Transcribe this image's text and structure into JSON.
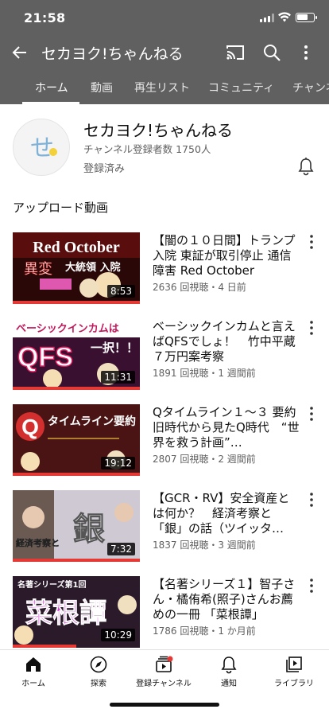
{
  "status_bar": {
    "time": "21:58"
  },
  "app_bar": {
    "title": "セカヨク!ちゃんねる",
    "icons": [
      "back-arrow-icon",
      "cast-icon",
      "search-icon",
      "more-vert-icon"
    ]
  },
  "tabs": [
    {
      "label": "ホーム",
      "active": true
    },
    {
      "label": "動画",
      "active": false
    },
    {
      "label": "再生リスト",
      "active": false
    },
    {
      "label": "コミュニティ",
      "active": false
    },
    {
      "label": "チャンネル",
      "active": false
    }
  ],
  "channel": {
    "name": "セカヨク!ちゃんねる",
    "subscribers": "チャンネル登録者数 1750人",
    "subscribed_label": "登録済み",
    "avatar_glyph": "せ"
  },
  "section": {
    "title": "アップロード動画"
  },
  "videos": [
    {
      "title": "【闇の１０日間】トランプ入院 東証が取引停止 通信障害 Red October",
      "meta": "2636 回視聴・4 日前",
      "duration": "8:53",
      "thumb_text": [
        "Red October",
        "異変",
        "大統領 入院"
      ],
      "progress": 1.0
    },
    {
      "title": "ベーシックインカムと言えばQFSでしょ！　竹中平蔵７万円案考察",
      "meta": "1891 回視聴・1 週間前",
      "duration": "11:31",
      "thumb_text": [
        "ベーシックインカムは",
        "QFS",
        "一択！！"
      ],
      "progress": 1.0
    },
    {
      "title": "Qタイムライン１〜３ 要約　旧時代から見たQ時代　“世界を救う計画”…",
      "meta": "2807 回視聴・2 週間前",
      "duration": "19:12",
      "thumb_text": [
        "Q",
        "タイムライン要約"
      ],
      "progress": 1.0
    },
    {
      "title": "【GCR・RV】安全資産とは何か？　経済考察と「銀」の話（ツイッタ…",
      "meta": "1837 回視聴・3 週間前",
      "duration": "7:32",
      "thumb_text": [
        "銀",
        "経済考察と"
      ],
      "progress": 1.0
    },
    {
      "title": "【名著シリーズ１】智子さん・橘侑希(照子)さんお薦めの一冊 「菜根譚」",
      "meta": "1786 回視聴・1 か月前",
      "duration": "10:29",
      "thumb_text": [
        "菜根譚",
        "名著シリーズ第1回"
      ],
      "progress": 0.5
    }
  ],
  "bottom_nav": [
    {
      "label": "ホーム",
      "icon": "home-icon",
      "active": true
    },
    {
      "label": "探索",
      "icon": "explore-icon",
      "active": false
    },
    {
      "label": "登録チャンネル",
      "icon": "subscriptions-icon",
      "active": false
    },
    {
      "label": "通知",
      "icon": "notifications-icon",
      "active": false
    },
    {
      "label": "ライブラリ",
      "icon": "library-icon",
      "active": false
    }
  ],
  "colors": {
    "header": "#606060",
    "progress": "#e53935",
    "text": "#0f0f0f",
    "secondary": "#606060"
  }
}
